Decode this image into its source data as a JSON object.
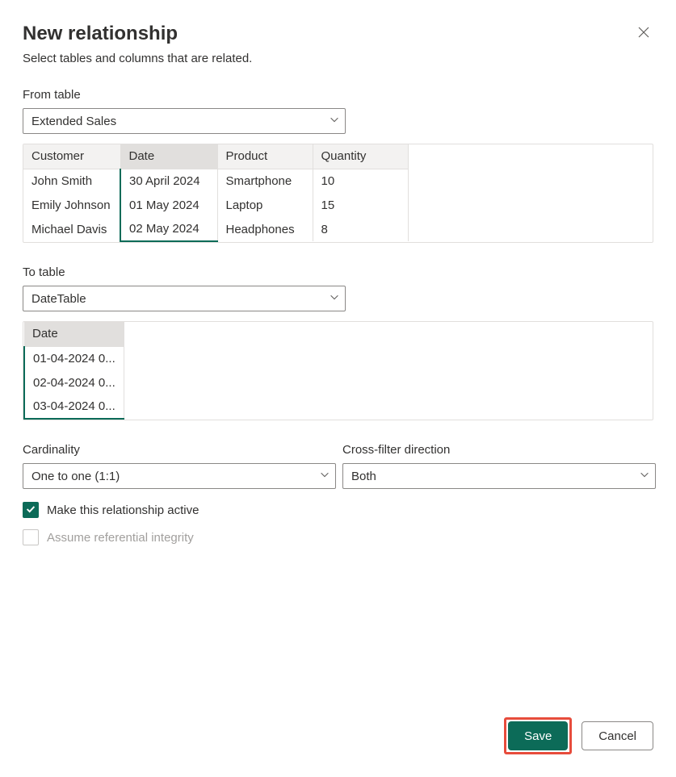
{
  "dialog": {
    "title": "New relationship",
    "subtitle": "Select tables and columns that are related."
  },
  "from": {
    "label": "From table",
    "selected": "Extended Sales",
    "columns": [
      "Customer",
      "Date",
      "Product",
      "Quantity"
    ],
    "selected_column_index": 1,
    "rows": [
      [
        "John Smith",
        "30 April 2024",
        "Smartphone",
        "10"
      ],
      [
        "Emily Johnson",
        "01 May 2024",
        "Laptop",
        "15"
      ],
      [
        "Michael Davis",
        "02 May 2024",
        "Headphones",
        "8"
      ]
    ]
  },
  "to": {
    "label": "To table",
    "selected": "DateTable",
    "columns": [
      "Date"
    ],
    "selected_column_index": 0,
    "rows": [
      [
        "01-04-2024 0..."
      ],
      [
        "02-04-2024 0..."
      ],
      [
        "03-04-2024 0..."
      ]
    ]
  },
  "cardinality": {
    "label": "Cardinality",
    "selected": "One to one (1:1)"
  },
  "crossfilter": {
    "label": "Cross-filter direction",
    "selected": "Both"
  },
  "checkboxes": {
    "active": {
      "label": "Make this relationship active",
      "checked": true,
      "disabled": false
    },
    "referential": {
      "label": "Assume referential integrity",
      "checked": false,
      "disabled": true
    }
  },
  "buttons": {
    "save": "Save",
    "cancel": "Cancel"
  }
}
